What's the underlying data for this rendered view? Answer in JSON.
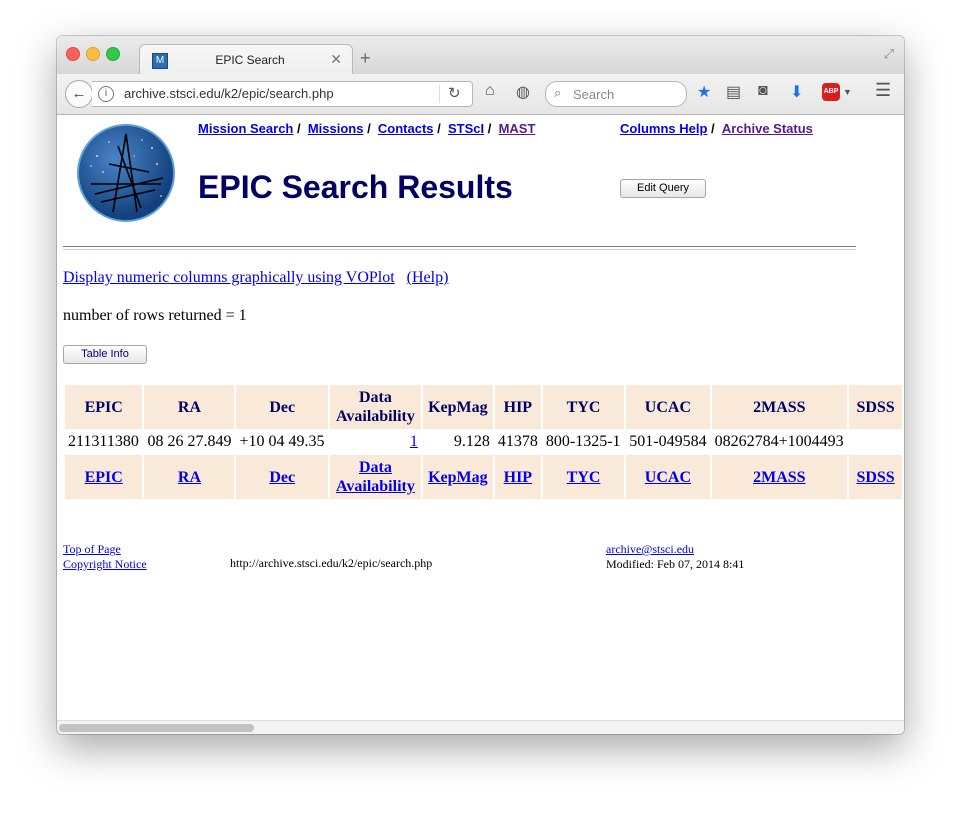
{
  "browser": {
    "tab_title": "EPIC Search",
    "tab_favicon": "M",
    "url": "archive.stsci.edu/k2/epic/search.php",
    "search_placeholder": "Search",
    "abp_label": "ABP"
  },
  "header": {
    "nav_links": [
      "Mission Search",
      "Missions",
      "Contacts",
      "STScI",
      "MAST"
    ],
    "help_links": [
      "Columns Help",
      "Archive Status"
    ],
    "title": "EPIC Search Results",
    "edit_query": "Edit Query"
  },
  "main": {
    "voplot_link": "Display numeric columns graphically using VOPlot",
    "help_link": "(Help)",
    "rows_returned": "number of rows returned = 1",
    "table_info_button": "Table Info"
  },
  "table": {
    "headers": [
      "EPIC",
      "RA",
      "Dec",
      "Data Availability",
      "KepMag",
      "HIP",
      "TYC",
      "UCAC",
      "2MASS",
      "SDSS"
    ],
    "rows": [
      [
        "211311380",
        "08 26 27.849",
        "+10 04 49.35",
        "1",
        "9.128",
        "41378",
        "800-1325-1",
        "501-049584",
        "08262784+1004493",
        ""
      ]
    ]
  },
  "footer": {
    "top_of_page": "Top of Page",
    "copyright": "Copyright Notice",
    "page_url": "http://archive.stsci.edu/k2/epic/search.php",
    "email": "archive@stsci.edu",
    "modified": "Modified: Feb 07, 2014 8:41"
  },
  "colors": {
    "title": "#000066",
    "header_bg": "#f9e9d8",
    "link": "#0000ee",
    "visited": "#551a8b"
  }
}
